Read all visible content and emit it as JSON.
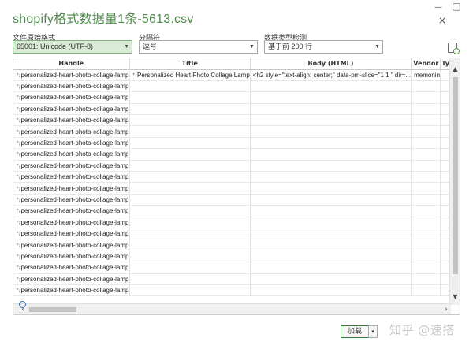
{
  "window": {
    "title": "shopify格式数据量1条-5613.csv",
    "minimize": "—",
    "maximize": "□",
    "close": "×"
  },
  "options": {
    "file_origin": {
      "label": "文件原始格式",
      "value": "65001: Unicode (UTF-8)"
    },
    "delimiter": {
      "label": "分隔符",
      "value": "逗号"
    },
    "type_detection": {
      "label": "数据类型检测",
      "value": "基于前 200 行"
    }
  },
  "table": {
    "columns": [
      "Handle",
      "Title",
      "Body (HTML)",
      "Vendor",
      "Type"
    ],
    "rows": [
      [
        "personalized-heart-photo-collage-lamp",
        "Personalized Heart Photo Collage Lamp",
        "<h2 style=\"text-align: center;\" data-pm-slice=\"1 1 \" dir=...",
        "memonin",
        ""
      ],
      [
        "personalized-heart-photo-collage-lamp",
        "",
        "",
        "",
        ""
      ],
      [
        "personalized-heart-photo-collage-lamp",
        "",
        "",
        "",
        ""
      ],
      [
        "personalized-heart-photo-collage-lamp",
        "",
        "",
        "",
        ""
      ],
      [
        "personalized-heart-photo-collage-lamp",
        "",
        "",
        "",
        ""
      ],
      [
        "personalized-heart-photo-collage-lamp",
        "",
        "",
        "",
        ""
      ],
      [
        "personalized-heart-photo-collage-lamp",
        "",
        "",
        "",
        ""
      ],
      [
        "personalized-heart-photo-collage-lamp",
        "",
        "",
        "",
        ""
      ],
      [
        "personalized-heart-photo-collage-lamp",
        "",
        "",
        "",
        ""
      ],
      [
        "personalized-heart-photo-collage-lamp",
        "",
        "",
        "",
        ""
      ],
      [
        "personalized-heart-photo-collage-lamp",
        "",
        "",
        "",
        ""
      ],
      [
        "personalized-heart-photo-collage-lamp",
        "",
        "",
        "",
        ""
      ],
      [
        "personalized-heart-photo-collage-lamp",
        "",
        "",
        "",
        ""
      ],
      [
        "personalized-heart-photo-collage-lamp",
        "",
        "",
        "",
        ""
      ],
      [
        "personalized-heart-photo-collage-lamp",
        "",
        "",
        "",
        ""
      ],
      [
        "personalized-heart-photo-collage-lamp",
        "",
        "",
        "",
        ""
      ],
      [
        "personalized-heart-photo-collage-lamp",
        "",
        "",
        "",
        ""
      ],
      [
        "personalized-heart-photo-collage-lamp",
        "",
        "",
        "",
        ""
      ],
      [
        "personalized-heart-photo-collage-lamp",
        "",
        "",
        "",
        ""
      ],
      [
        "personalized-heart-photo-collage-lamp",
        "",
        "",
        "",
        ""
      ]
    ]
  },
  "footer": {
    "load_label": "加载",
    "load_dropdown": "▾",
    "watermark": "知乎 @速搭"
  },
  "colors": {
    "title": "#4f8a4a",
    "selected_dropdown": "#d9ead6",
    "load_border": "#2e7d32"
  }
}
